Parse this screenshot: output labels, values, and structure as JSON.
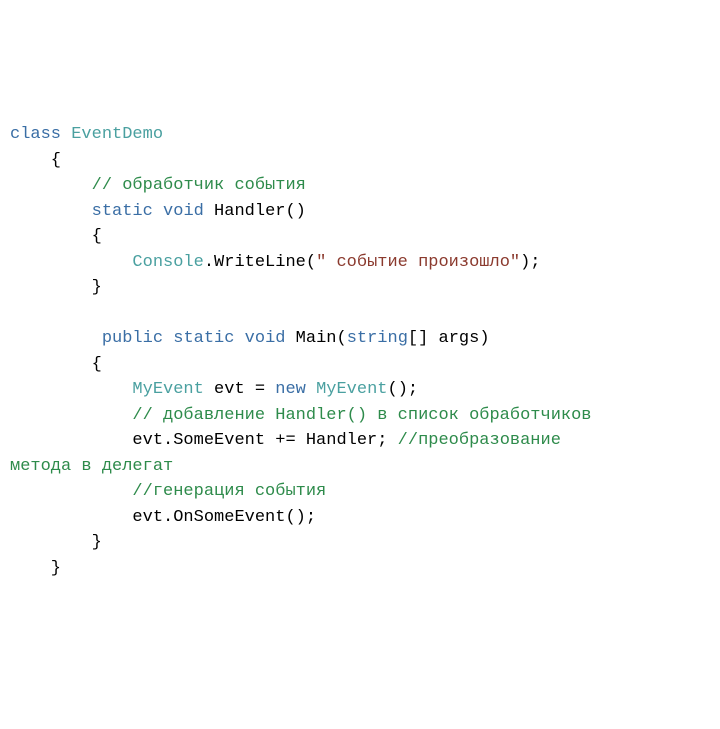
{
  "colors": {
    "keyword": "#3a6ea5",
    "type": "#4aa0a0",
    "comment": "#2e8b4b",
    "string": "#8b3a2e",
    "plain": "#000000",
    "background": "#ffffff"
  },
  "code": {
    "l1": {
      "kw_class": "class",
      "type_eventdemo": "EventDemo"
    },
    "l2": {
      "brace": "    {"
    },
    "l3": {
      "indent": "        ",
      "comment": "// обработчик события"
    },
    "l4": {
      "indent": "        ",
      "kw_static": "static",
      "kw_void": "void",
      "name": " Handler()"
    },
    "l5": {
      "brace": "        {"
    },
    "l6": {
      "indent": "            ",
      "type_console": "Console",
      "dot_write": ".WriteLine(",
      "str": "\" событие произошло\"",
      "close": ");"
    },
    "l7": {
      "brace": "        }"
    },
    "l8": {
      "blank": ""
    },
    "l9": {
      "indent": "         ",
      "kw_public": "public",
      "kw_static": "static",
      "kw_void": "void",
      "name_main": " Main(",
      "kw_string": "string",
      "args": "[] args)"
    },
    "l10": {
      "brace": "        {"
    },
    "l11": {
      "indent": "            ",
      "type_myevent": "MyEvent",
      "evt": " evt = ",
      "kw_new": "new",
      "sp": " ",
      "type_myevent2": "MyEvent",
      "close": "();"
    },
    "l12": {
      "indent": "            ",
      "comment": "// добавление Handler() в список обработчиков"
    },
    "l13": {
      "indent": "            ",
      "stmt": "evt.SomeEvent += Handler; ",
      "comment": "//преобразование"
    },
    "l14": {
      "comment": "метода в делегат"
    },
    "l15": {
      "indent": "            ",
      "comment": "//генерация события"
    },
    "l16": {
      "indent": "            ",
      "stmt": "evt.OnSomeEvent();"
    },
    "l17": {
      "brace": "        }"
    },
    "l18": {
      "brace": "    }"
    }
  }
}
